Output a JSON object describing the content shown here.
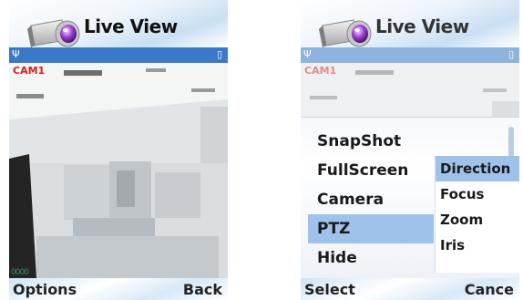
{
  "left_screen": {
    "title": "Live View",
    "camera_label": "CAM1",
    "timestamp": "0000",
    "softkey_left": "Options",
    "softkey_right": "Back"
  },
  "right_screen": {
    "title": "Live View",
    "camera_label": "CAM1",
    "menu": [
      "SnapShot",
      "FullScreen",
      "Camera",
      "PTZ",
      "Hide"
    ],
    "menu_selected": "PTZ",
    "submenu": [
      "Direction",
      "Focus",
      "Zoom",
      "Iris"
    ],
    "submenu_selected": "Direction",
    "softkey_left": "Select",
    "softkey_right": "Cance"
  },
  "icons": {
    "app": "camera-icon",
    "signal": "signal-icon",
    "battery": "battery-icon"
  },
  "colors": {
    "status_bar": "#3a79c9",
    "selection": "#9ec2ea",
    "camera_label": "#d42020"
  }
}
